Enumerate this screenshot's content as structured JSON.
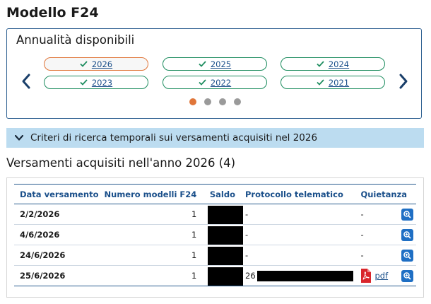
{
  "page_title": "Modello F24",
  "years_panel": {
    "title": "Annualità disponibili",
    "years": [
      {
        "label": "2026",
        "active": true
      },
      {
        "label": "2025",
        "active": false
      },
      {
        "label": "2024",
        "active": false
      },
      {
        "label": "2023",
        "active": false
      },
      {
        "label": "2022",
        "active": false
      },
      {
        "label": "2021",
        "active": false
      }
    ],
    "prev_icon": "chevron-left-icon",
    "next_icon": "chevron-right-icon",
    "page_count": 4,
    "current_page": 1
  },
  "criteria": {
    "label": "Criteri di ricerca temporali sui versamenti acquisiti nel 2026",
    "icon": "chevron-down-icon"
  },
  "section_title": "Versamenti acquisiti nell'anno 2026 (4)",
  "table": {
    "headers": [
      "Data versamento",
      "Numero modelli F24",
      "Saldo",
      "Protocollo telematico",
      "Quietanza"
    ],
    "rows": [
      {
        "date": "2/2/2026",
        "count": "1",
        "currency": "€",
        "protocol": "-",
        "receipt": "-",
        "receipt_pdf": false
      },
      {
        "date": "4/6/2026",
        "count": "1",
        "currency": "€",
        "protocol": "-",
        "receipt": "-",
        "receipt_pdf": false
      },
      {
        "date": "24/6/2026",
        "count": "1",
        "currency": "€",
        "protocol": "-",
        "receipt": "-",
        "receipt_pdf": false
      },
      {
        "date": "25/6/2026",
        "count": "1",
        "currency": "€",
        "protocol": "26",
        "receipt": "pdf",
        "receipt_pdf": true
      }
    ]
  },
  "colors": {
    "primary": "#1a4f8a",
    "active_orange": "#e0763a",
    "check_green": "#1c8c5e",
    "criteria_bg": "#bcdcf0",
    "zoom_button": "#1f6fc4",
    "pdf_red": "#d9262c"
  }
}
